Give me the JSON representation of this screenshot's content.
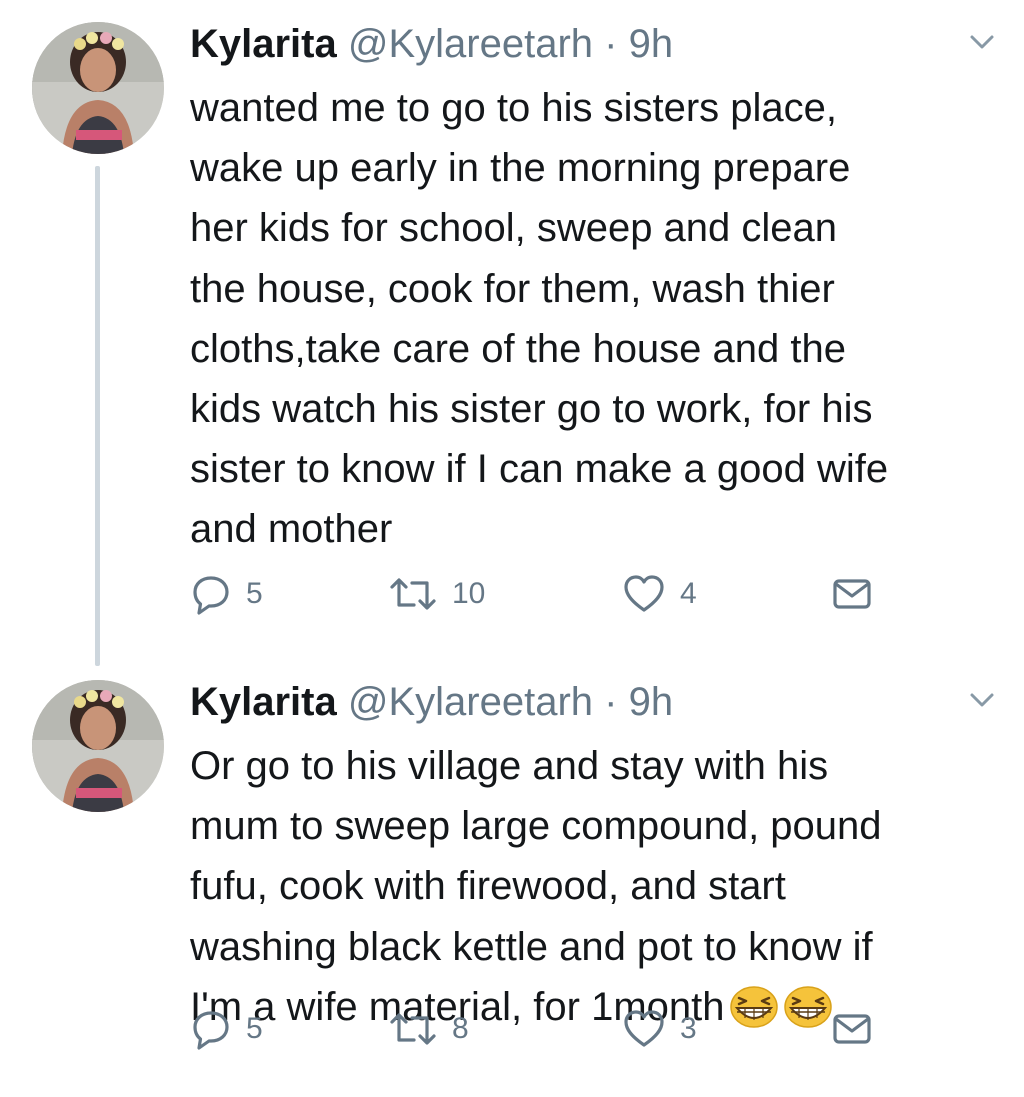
{
  "tweets": [
    {
      "display_name": "Kylarita",
      "handle": "@Kylareetarh",
      "separator": "·",
      "time": "9h",
      "text_lines": [
        "wanted me to go to his sisters place,",
        "wake up early in the morning prepare",
        "her kids for school, sweep and clean",
        "the house, cook for them, wash thier",
        "cloths,take care of the house and the",
        "kids watch his sister go to work, for his",
        "sister to know if I can make a good wife",
        "and mother"
      ],
      "replies": "5",
      "retweets": "10",
      "likes": "4"
    },
    {
      "display_name": "Kylarita",
      "handle": "@Kylareetarh",
      "separator": "·",
      "time": "9h",
      "text_lines": [
        "Or go to his village and stay with his",
        "mum to sweep large compound, pound",
        "fufu, cook with firewood, and start",
        "washing black kettle and pot to know if",
        "I'm a wife material, for 1month"
      ],
      "trailing_emoji": [
        "grinning-squinting-face-emoji",
        "grinning-squinting-face-emoji"
      ],
      "replies": "5",
      "retweets": "8",
      "likes": "3"
    }
  ],
  "icons": {
    "reply": "reply-icon",
    "retweet": "retweet-icon",
    "like": "heart-icon",
    "dm": "envelope-icon",
    "menu": "chevron-down-icon"
  },
  "colors": {
    "text": "#14171a",
    "secondary": "#657786",
    "thread_line": "#cdd6dd",
    "emoji": "#f5c33b"
  }
}
